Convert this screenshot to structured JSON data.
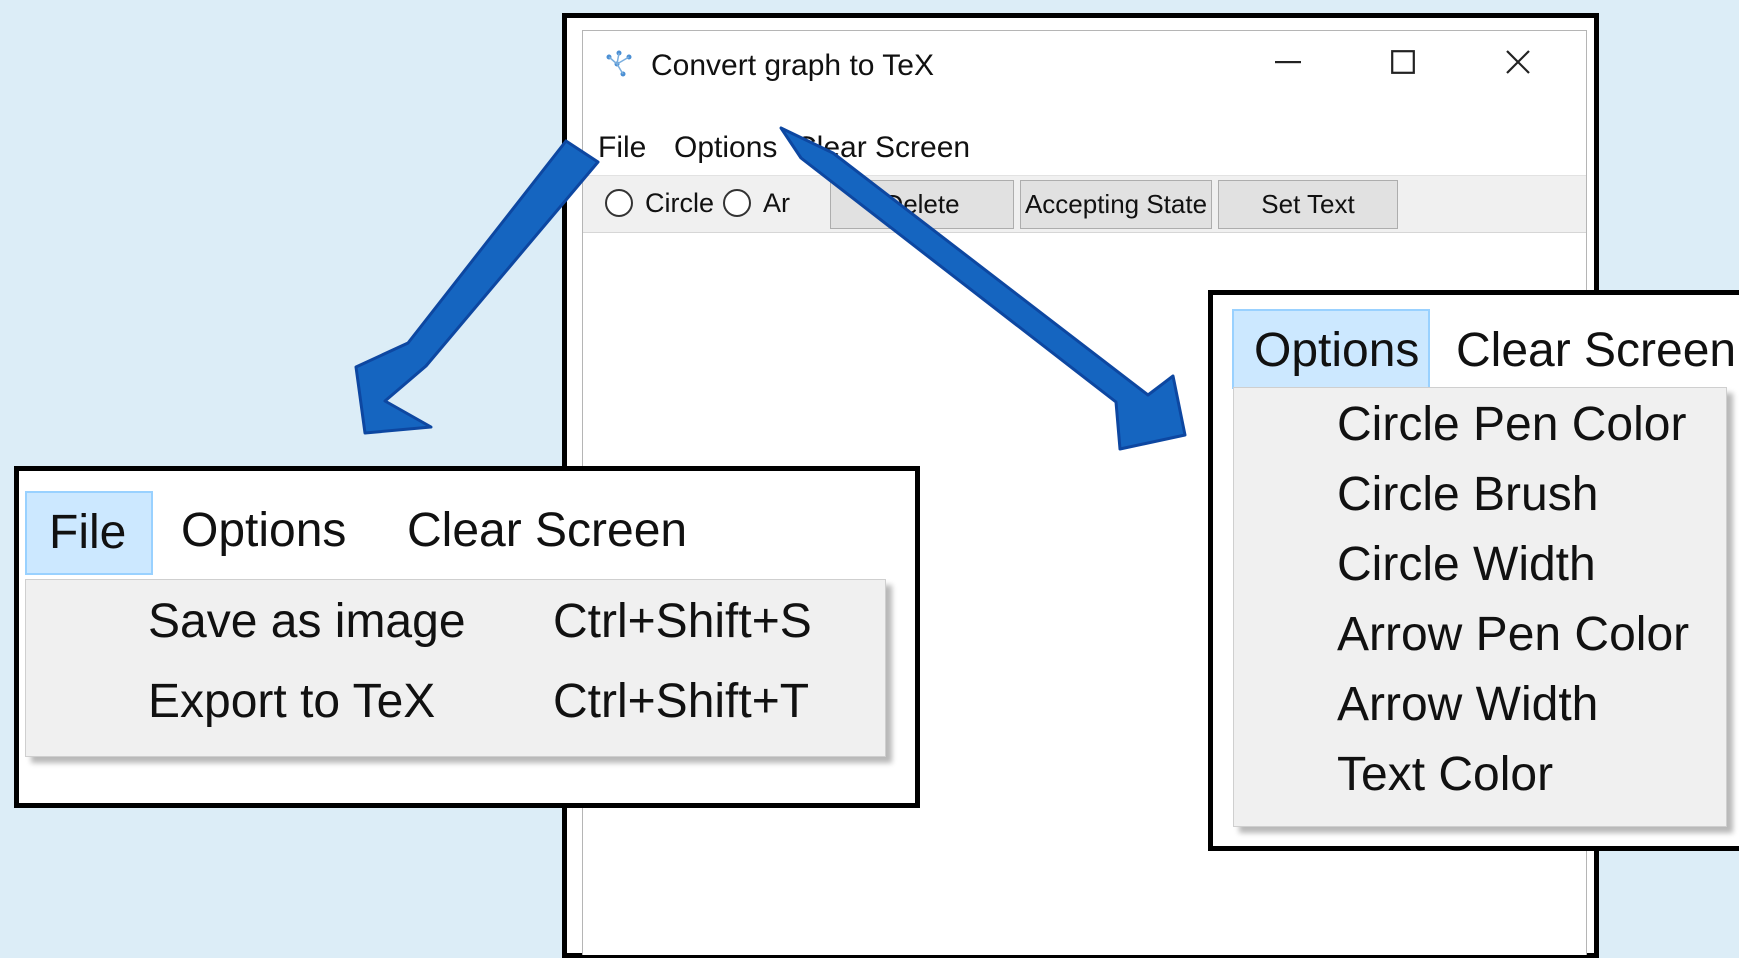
{
  "window": {
    "title": "Convert graph to TeX",
    "menu": [
      "File",
      "Options",
      "Clear Screen"
    ],
    "toolbar": {
      "radio_circle": "Circle",
      "radio_arrow_partial": "Ar",
      "delete": "Delete",
      "accepting_state": "Accepting State",
      "set_text": "Set Text"
    }
  },
  "file_callout": {
    "menu": [
      "File",
      "Options",
      "Clear Screen"
    ],
    "items": [
      {
        "label": "Save as image",
        "shortcut": "Ctrl+Shift+S"
      },
      {
        "label": "Export to TeX",
        "shortcut": "Ctrl+Shift+T"
      }
    ]
  },
  "options_callout": {
    "menu": [
      "Options",
      "Clear Screen"
    ],
    "items": [
      "Circle Pen Color",
      "Circle Brush",
      "Circle Width",
      "Arrow Pen Color",
      "Arrow Width",
      "Text Color"
    ]
  },
  "colors": {
    "background": "#dcedf7",
    "arrow": "#1565c0",
    "highlight": "#cce8ff",
    "menu_bg": "#f0f0f0"
  }
}
